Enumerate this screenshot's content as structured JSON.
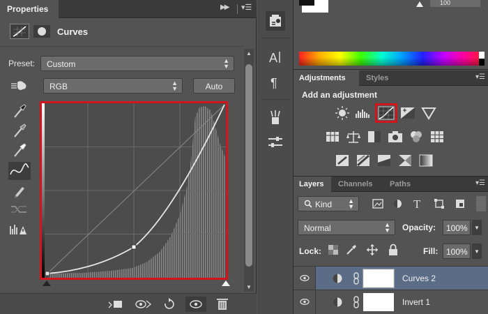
{
  "properties": {
    "tab_label": "Properties",
    "panel_type": "Curves",
    "preset_label": "Preset:",
    "preset_value": "Custom",
    "channel_value": "RGB",
    "auto_label": "Auto"
  },
  "color_panel": {
    "value": "100"
  },
  "adjustments": {
    "tabs": [
      "Adjustments",
      "Styles"
    ],
    "title": "Add an adjustment",
    "highlight_color": "#d3141a"
  },
  "layers": {
    "tabs": [
      "Layers",
      "Channels",
      "Paths"
    ],
    "filter_kind": "Kind",
    "blend_mode": "Normal",
    "opacity_label": "Opacity:",
    "opacity_value": "100%",
    "lock_label": "Lock:",
    "fill_label": "Fill:",
    "fill_value": "100%",
    "items": [
      {
        "name": "Curves 2",
        "selected": true
      },
      {
        "name": "Invert 1",
        "selected": false
      }
    ]
  },
  "curve": {
    "control_points": [
      [
        0,
        0
      ],
      [
        128,
        40
      ],
      [
        255,
        255
      ]
    ]
  },
  "colors": {
    "accent_red": "#d3141a",
    "panel_bg": "#535353",
    "selected_layer": "#5b6c86"
  }
}
